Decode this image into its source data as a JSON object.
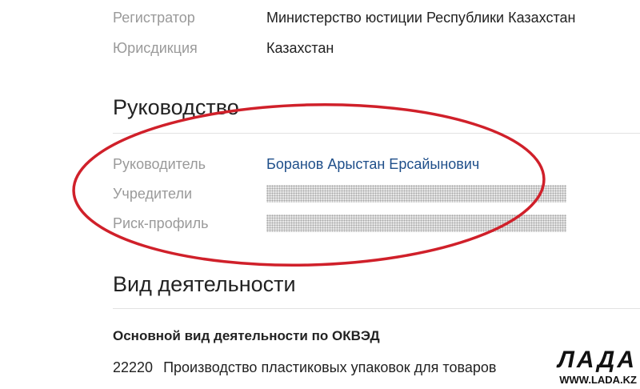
{
  "registration": {
    "registrar_label": "Регистратор",
    "registrar_value": "Министерство юстиции Республики Казахстан",
    "jurisdiction_label": "Юрисдикция",
    "jurisdiction_value": "Казахстан"
  },
  "management": {
    "title": "Руководство",
    "director_label": "Руководитель",
    "director_value": "Боранов Арыстан Ерсайынович",
    "founders_label": "Учредители",
    "risk_label": "Риск-профиль"
  },
  "activity": {
    "title": "Вид деятельности",
    "main_label": "Основной вид деятельности по ОКВЭД",
    "code": "22220",
    "description": "Производство пластиковых упаковок для товаров"
  },
  "watermark": {
    "logo": "ЛАДА",
    "url": "WWW.LADA.KZ"
  },
  "colors": {
    "label": "#9a9a9a",
    "text": "#222222",
    "link": "#1f4f8a",
    "annotation_ellipse": "#d0202a",
    "divider": "#e2e2e2"
  }
}
